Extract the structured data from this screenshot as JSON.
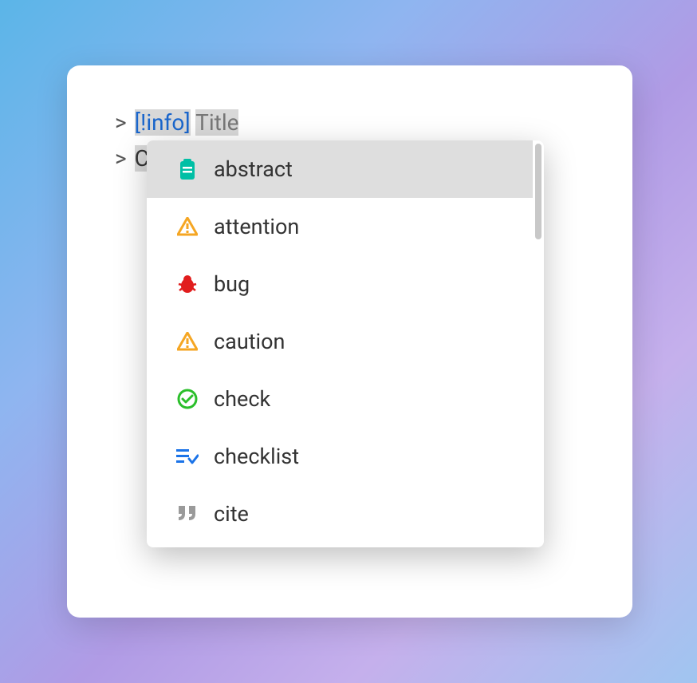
{
  "editor": {
    "line1": {
      "chevron": ">",
      "lbracket": "[",
      "bangtag": "!info",
      "rbracket": "]",
      "space": " ",
      "title": "Title"
    },
    "line2": {
      "chevron": ">",
      "content": "C"
    }
  },
  "suggestions": {
    "items": [
      {
        "label": "abstract",
        "icon": "clipboard-icon",
        "color": "#00bfa5",
        "selected": true
      },
      {
        "label": "attention",
        "icon": "warning-icon",
        "color": "#f5a623",
        "selected": false
      },
      {
        "label": "bug",
        "icon": "bug-icon",
        "color": "#e11d1d",
        "selected": false
      },
      {
        "label": "caution",
        "icon": "warning-icon",
        "color": "#f5a623",
        "selected": false
      },
      {
        "label": "check",
        "icon": "check-circle-icon",
        "color": "#2bbf2b",
        "selected": false
      },
      {
        "label": "checklist",
        "icon": "list-check-icon",
        "color": "#1a73e8",
        "selected": false
      },
      {
        "label": "cite",
        "icon": "quote-icon",
        "color": "#9a9a9a",
        "selected": false
      }
    ]
  }
}
